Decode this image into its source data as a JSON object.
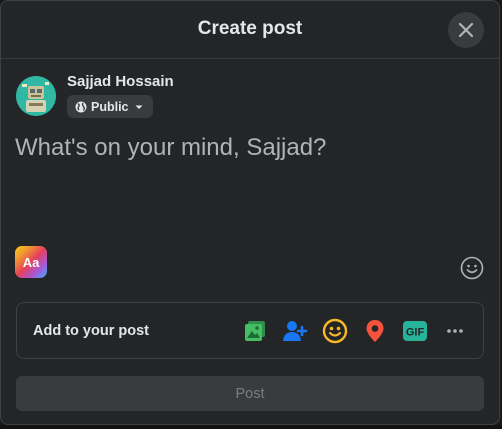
{
  "header": {
    "title": "Create post"
  },
  "user": {
    "name": "Sajjad Hossain",
    "privacy_label": "Public"
  },
  "composer": {
    "placeholder": "What's on your mind, Sajjad?"
  },
  "text_style": {
    "label": "Aa"
  },
  "add_to_post": {
    "label": "Add to your post",
    "actions": [
      {
        "name": "photo-video",
        "icon": "photo-icon",
        "color": "#45bd62"
      },
      {
        "name": "tag-people",
        "icon": "tag-people-icon",
        "color": "#1877f2"
      },
      {
        "name": "feeling-activity",
        "icon": "smiley-icon",
        "color": "#f7b928"
      },
      {
        "name": "check-in",
        "icon": "location-pin-icon",
        "color": "#f5533d"
      },
      {
        "name": "gif",
        "icon": "gif-icon",
        "label": "GIF",
        "color": "#27b39a"
      },
      {
        "name": "more",
        "icon": "more-icon",
        "color": "#b0b3b8"
      }
    ]
  },
  "post_button": {
    "label": "Post"
  },
  "colors": {
    "background": "#242526",
    "surface": "#3a3b3c",
    "text_primary": "#e4e6eb",
    "text_secondary": "#b0b3b8"
  }
}
